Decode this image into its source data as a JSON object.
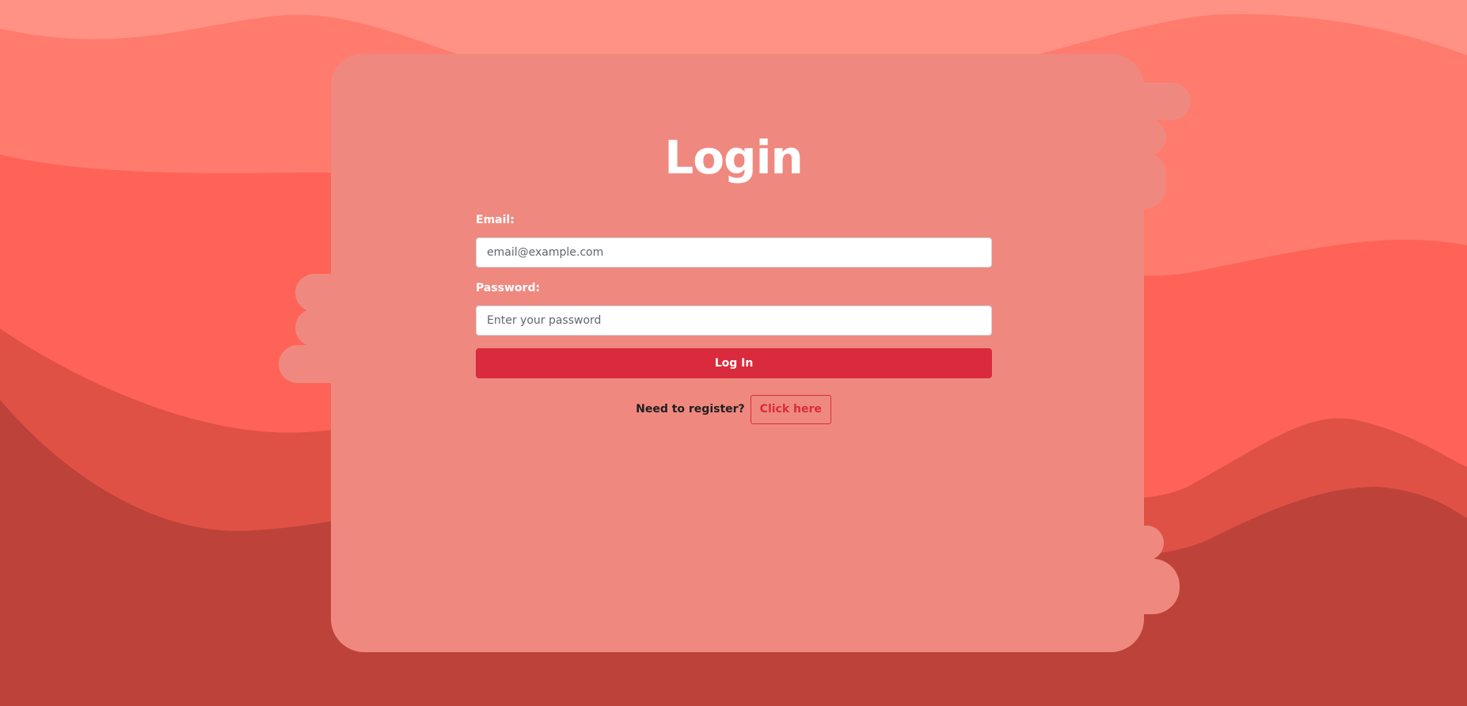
{
  "login": {
    "title": "Login",
    "email_label": "Email:",
    "email_placeholder": "email@example.com",
    "password_label": "Password:",
    "password_placeholder": "Enter your password",
    "submit_label": "Log In",
    "register_prompt": "Need to register?",
    "register_link": "Click here"
  },
  "colors": {
    "background_top": "#ff9285",
    "background_light": "#ff7b6d",
    "background_mid": "#ff6357",
    "background_dark": "#e05145",
    "background_darkest": "#bd423a",
    "card": "#ef8980",
    "accent": "#d92b3d"
  }
}
